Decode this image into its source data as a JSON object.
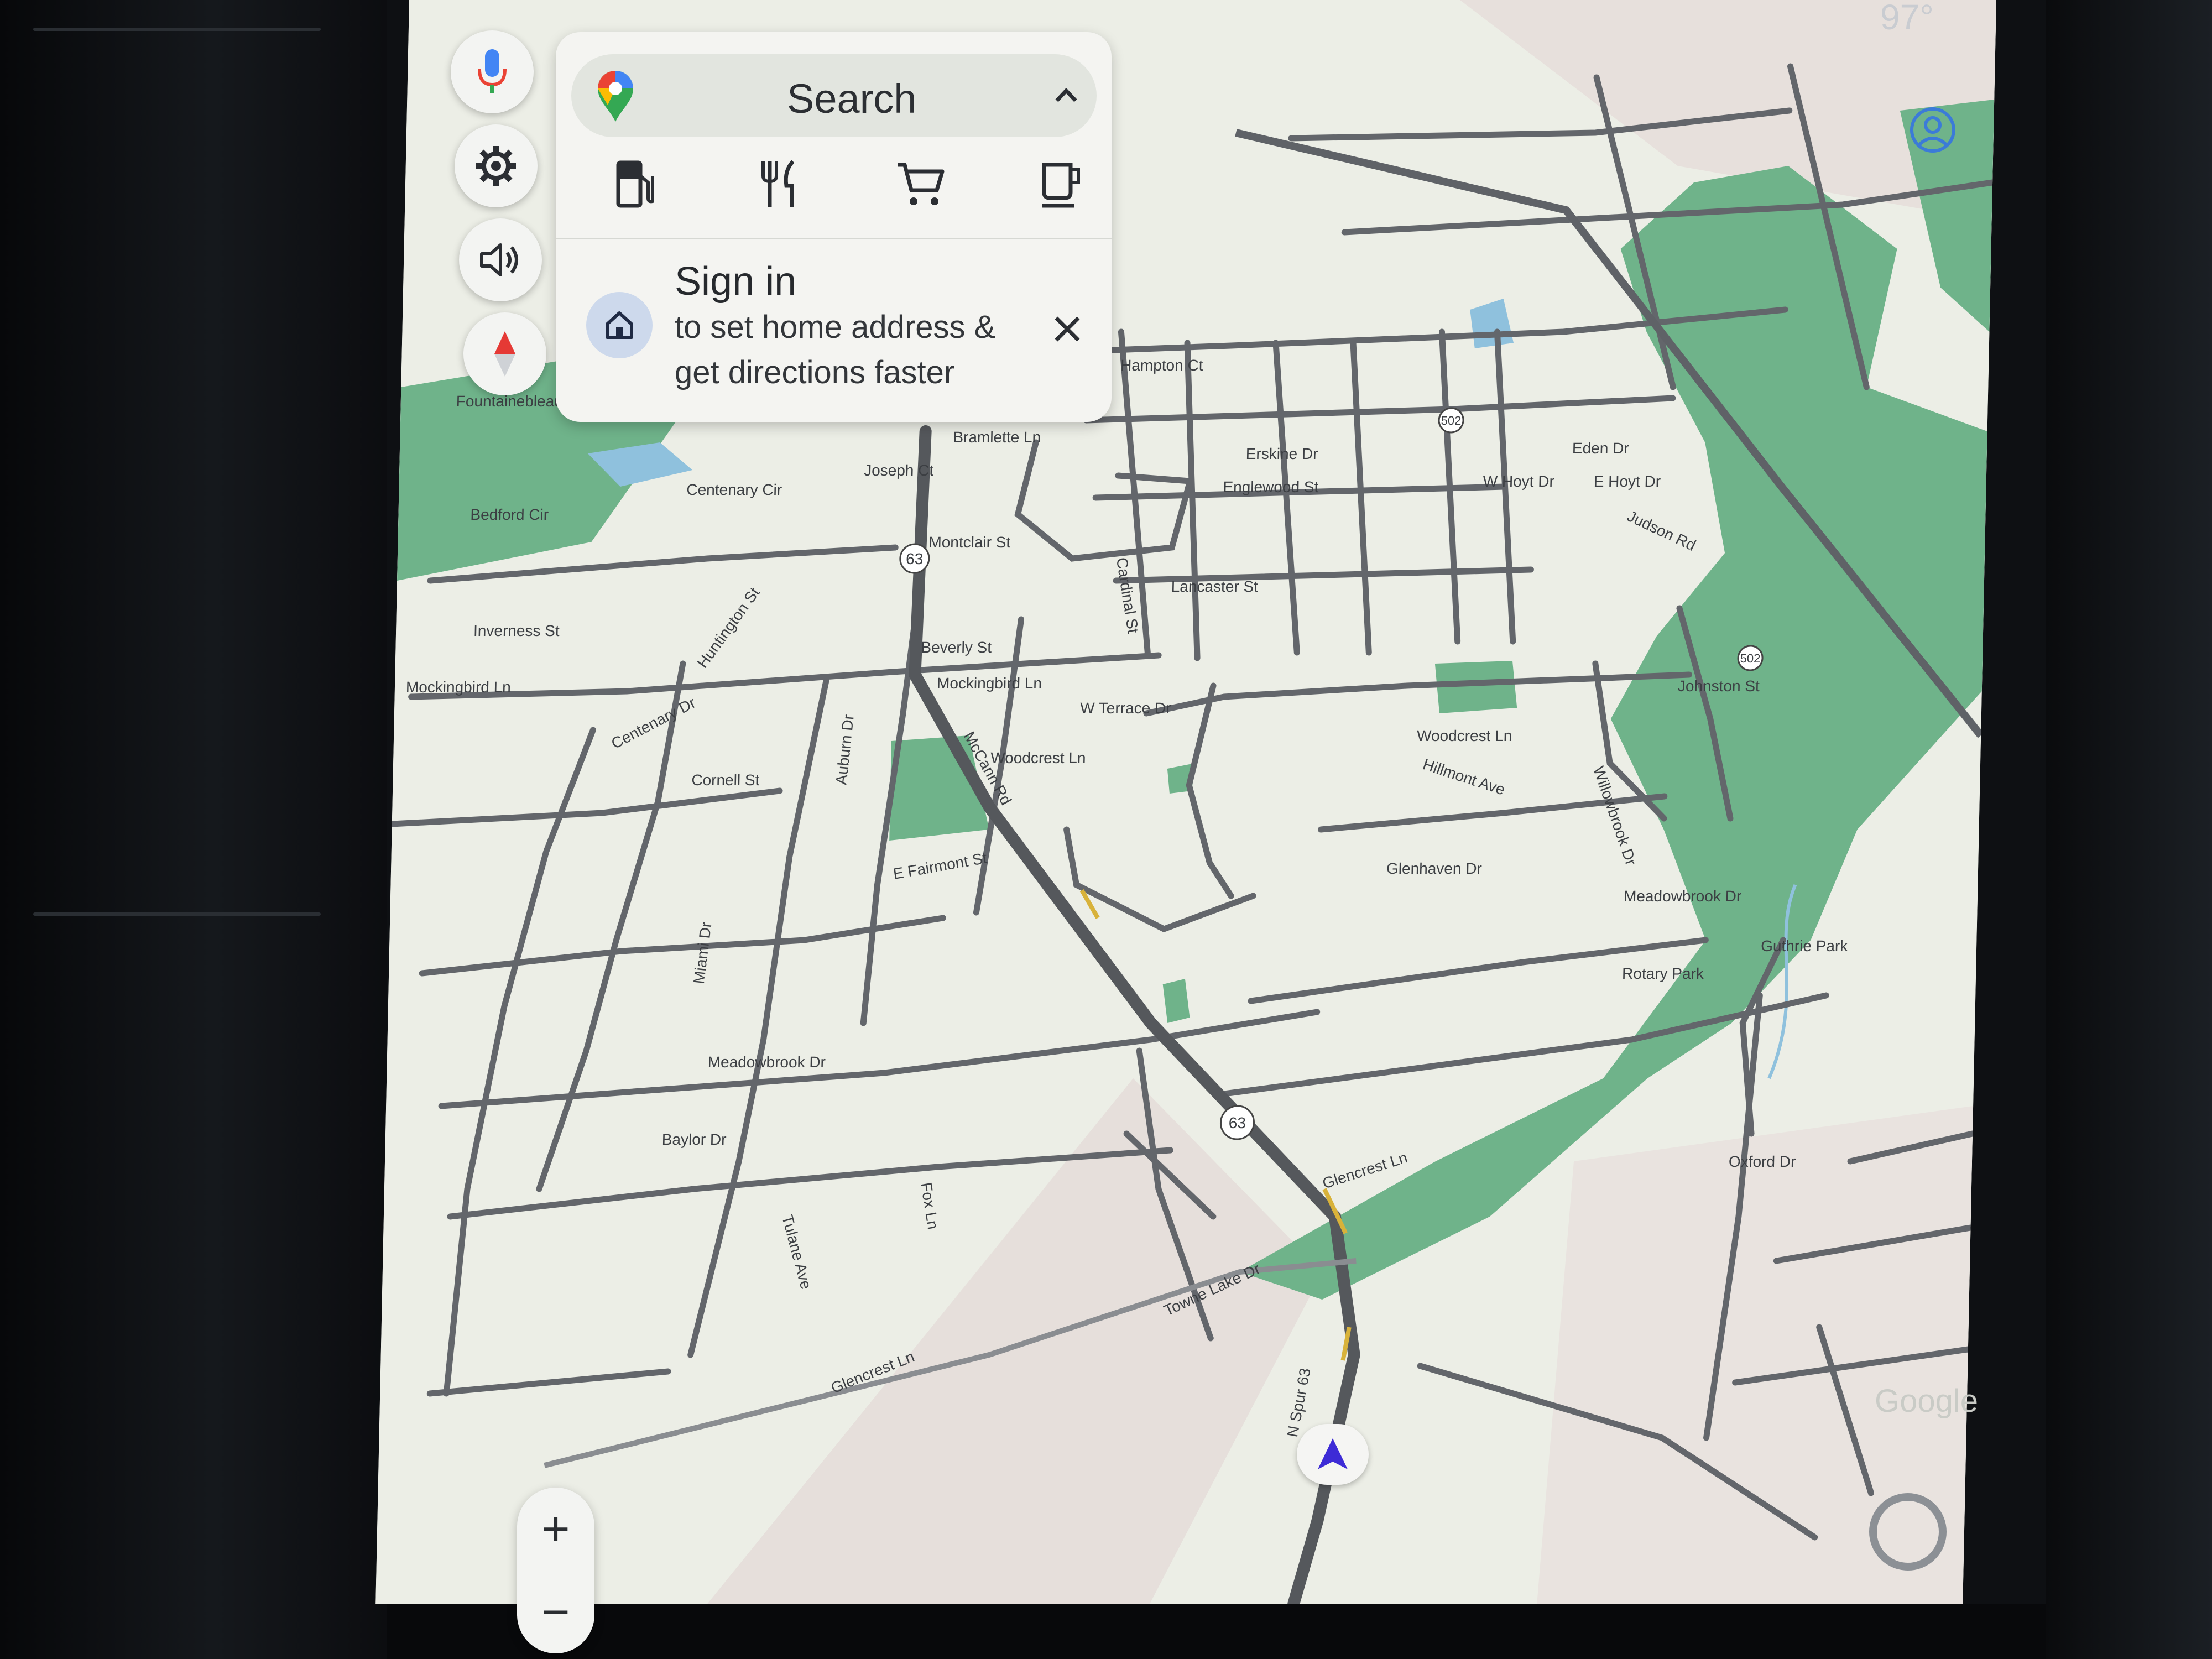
{
  "status": {
    "temperature": "97°"
  },
  "search": {
    "label": "Search",
    "categories": [
      "gas",
      "restaurants",
      "shopping",
      "coffee"
    ]
  },
  "signin": {
    "title": "Sign in",
    "line1": "to set home address &",
    "line2": "get directions faster"
  },
  "zoom": {
    "in_label": "+",
    "out_label": "−"
  },
  "map": {
    "watermark": "Google",
    "route_shields": [
      "63",
      "63",
      "502",
      "502"
    ],
    "streets": [
      "Joseph Ct",
      "Centenary Cir",
      "Bedford Cir",
      "Inverness St",
      "Mockingbird Ln",
      "Huntington St",
      "Centenary Dr",
      "Cornell St",
      "Auburn Dr",
      "Montclair St",
      "Beverly St",
      "Mockingbird Ln",
      "W Terrace Dr",
      "Woodcrest Ln",
      "McCann Rd",
      "E Fairmont St",
      "Miami Dr",
      "Meadowbrook Dr",
      "Baylor Dr",
      "Tulane Ave",
      "Fox Ln",
      "Glencrest Ln",
      "Towne Lake Dr",
      "N Spur 63",
      "Glencrest Ln",
      "Rotary Park",
      "Guthrie Park",
      "Hillmont Ave",
      "Glenhaven Dr",
      "Meadowbrook Dr",
      "Woodcrest Ln",
      "Johnston St",
      "Willowbrook Dr",
      "Oxford Dr",
      "Erskine Dr",
      "Englewood St",
      "Lancaster St",
      "Cardinal St",
      "Bramlette Ln",
      "Eden Dr",
      "W Hoyt Dr",
      "E Hoyt Dr",
      "Judson Rd",
      "Hampton Ct",
      "Fountainebleau"
    ]
  }
}
